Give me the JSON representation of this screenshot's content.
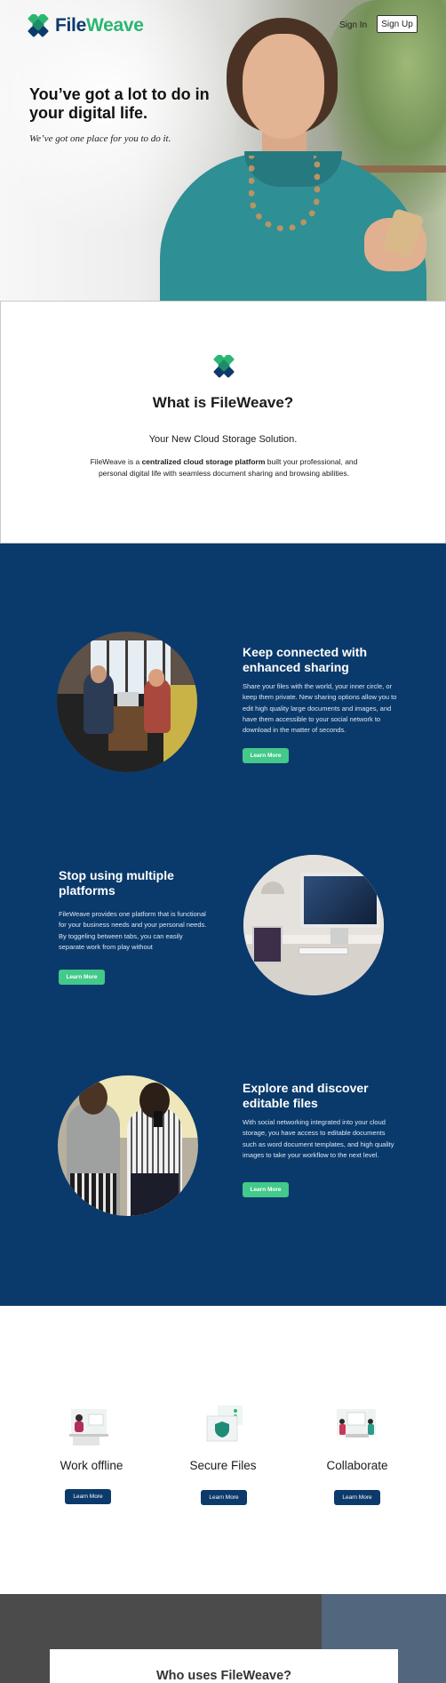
{
  "brand": {
    "name_part1": "File",
    "name_part2": "Weave",
    "primary_color": "#0c3a6b",
    "accent_color": "#2bb673"
  },
  "header": {
    "sign_in": "Sign In",
    "sign_up": "Sign Up"
  },
  "hero": {
    "title": "You’ve got a lot to do in your digital life.",
    "subtitle": "We’ve got one place for you to do it."
  },
  "about": {
    "title": "What is FileWeave?",
    "subtitle": "Your New Cloud Storage Solution.",
    "desc_before": "FileWeave is a ",
    "desc_bold": "centralized cloud storage platform",
    "desc_after": " built  your professional, and personal digital life with seamless document sharing and browsing abilities."
  },
  "features": [
    {
      "title": "Keep connected with enhanced sharing",
      "text": "Share your files with the world, your inner circle, or keep them private. New sharing options allow you to edit high quality large documents and images, and have them accessible to your social network to download in the matter of seconds.",
      "button": "Learn More"
    },
    {
      "title": "Stop using multiple platforms",
      "text": "FileWeave provides one platform that is functional for your business needs and your personal needs.  By toggeling between tabs, you can easily separate  work from play without",
      "button": "Learn More"
    },
    {
      "title": "Explore and discover editable files",
      "text": "With social networking integrated into your cloud storage, you have access to editable documents such as word document templates, and high quality images to take your workflow to the next level.",
      "button": "Learn More"
    }
  ],
  "services": [
    {
      "title": "Work offline",
      "button": "Learn More",
      "icon": "offline-work-icon"
    },
    {
      "title": "Secure Files",
      "button": "Learn More",
      "icon": "secure-files-icon"
    },
    {
      "title": "Collaborate",
      "button": "Learn More",
      "icon": "collaborate-icon"
    }
  ],
  "who": {
    "title": "Who uses FileWeave?"
  }
}
